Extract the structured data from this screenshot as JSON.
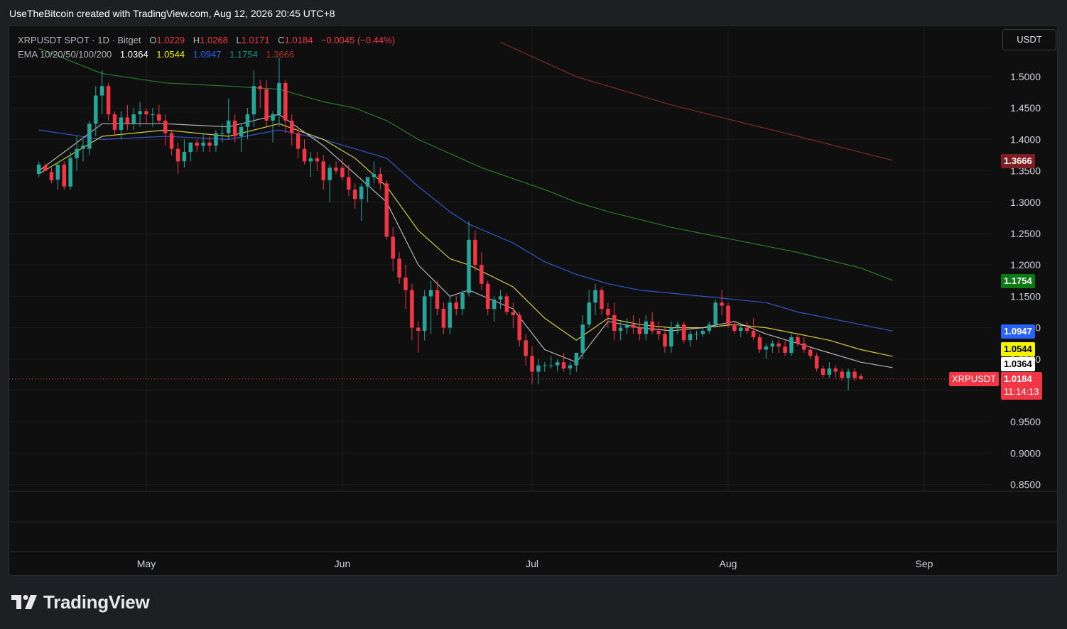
{
  "caption": "UseTheBitcoin created with TradingView.com, Aug 12, 2026 20:45 UTC+8",
  "legend": {
    "symbol": "XRPUSDT SPOT · 1D · Bitget",
    "o_label": "O",
    "o_value": "1.0229",
    "h_label": "H",
    "h_value": "1.0268",
    "l_label": "L",
    "l_value": "1.0171",
    "c_label": "C",
    "c_value": "1.0184",
    "change": "−0.0045 (−0.44%)",
    "ema_label": "EMA 10/20/50/100/200",
    "ema10": "1.0364",
    "ema20": "1.0544",
    "ema50": "1.0947",
    "ema100": "1.1754",
    "ema200": "1.3666"
  },
  "currency_button": "USDT",
  "price_labels": {
    "ema200": "1.3666",
    "ema100": "1.1754",
    "ema50": "1.0947",
    "ema20": "1.0544",
    "ema10": "1.0364",
    "symbol": "XRPUSDT",
    "last": "1.0184",
    "countdown": "11:14:13"
  },
  "colors": {
    "up": "#26a69a",
    "down": "#f23645",
    "ema10": "#c9c9c9",
    "ema20": "#e8e24a",
    "ema50": "#3b5ee0",
    "ema100": "#2e8b2e",
    "ema200": "#8b2f2f",
    "tag_ema200": "#7f1f22",
    "tag_ema100": "#0b7a12",
    "tag_ema50": "#2962ff",
    "tag_ema20": "#f5f500",
    "tag_ema10": "#ffffff",
    "tag_last": "#f23645"
  },
  "brand": "TradingView",
  "chart_data": {
    "type": "candlestick",
    "title": "XRPUSDT SPOT · 1D · Bitget",
    "y_ticks": [
      "1.5000",
      "1.4500",
      "1.4000",
      "1.3500",
      "1.3000",
      "1.2500",
      "1.2000",
      "1.1500",
      "1.1000",
      "1.0500",
      "1.0000",
      "0.9500",
      "0.9000",
      "0.8500"
    ],
    "ylim": [
      0.85,
      1.55
    ],
    "x_ticks": [
      "May",
      "Jun",
      "Jul",
      "Aug",
      "Sep"
    ],
    "x_tick_dates": [
      "2026-05-01",
      "2026-06-01",
      "2026-07-01",
      "2026-08-01",
      "2026-09-01"
    ],
    "start_date": "2026-04-14",
    "candles_ohlc": [
      [
        1.345,
        1.365,
        1.34,
        1.36
      ],
      [
        1.358,
        1.362,
        1.35,
        1.35
      ],
      [
        1.348,
        1.355,
        1.33,
        1.335
      ],
      [
        1.336,
        1.365,
        1.32,
        1.36
      ],
      [
        1.36,
        1.365,
        1.32,
        1.325
      ],
      [
        1.325,
        1.38,
        1.32,
        1.37
      ],
      [
        1.37,
        1.405,
        1.35,
        1.385
      ],
      [
        1.385,
        1.4,
        1.365,
        1.39
      ],
      [
        1.385,
        1.43,
        1.375,
        1.425
      ],
      [
        1.425,
        1.485,
        1.405,
        1.47
      ],
      [
        1.47,
        1.51,
        1.44,
        1.485
      ],
      [
        1.485,
        1.49,
        1.43,
        1.44
      ],
      [
        1.44,
        1.445,
        1.405,
        1.415
      ],
      [
        1.415,
        1.445,
        1.4,
        1.435
      ],
      [
        1.435,
        1.455,
        1.415,
        1.425
      ],
      [
        1.425,
        1.45,
        1.415,
        1.44
      ],
      [
        1.44,
        1.46,
        1.42,
        1.445
      ],
      [
        1.445,
        1.45,
        1.425,
        1.44
      ],
      [
        1.44,
        1.45,
        1.42,
        1.44
      ],
      [
        1.44,
        1.455,
        1.425,
        1.43
      ],
      [
        1.43,
        1.44,
        1.39,
        1.41
      ],
      [
        1.41,
        1.415,
        1.375,
        1.385
      ],
      [
        1.385,
        1.395,
        1.345,
        1.365
      ],
      [
        1.365,
        1.4,
        1.355,
        1.38
      ],
      [
        1.38,
        1.395,
        1.365,
        1.395
      ],
      [
        1.395,
        1.4,
        1.38,
        1.39
      ],
      [
        1.39,
        1.41,
        1.38,
        1.395
      ],
      [
        1.395,
        1.405,
        1.38,
        1.39
      ],
      [
        1.39,
        1.415,
        1.38,
        1.41
      ],
      [
        1.41,
        1.425,
        1.395,
        1.41
      ],
      [
        1.41,
        1.465,
        1.4,
        1.43
      ],
      [
        1.43,
        1.44,
        1.395,
        1.405
      ],
      [
        1.405,
        1.425,
        1.38,
        1.42
      ],
      [
        1.42,
        1.45,
        1.4,
        1.44
      ],
      [
        1.44,
        1.51,
        1.42,
        1.485
      ],
      [
        1.485,
        1.495,
        1.45,
        1.48
      ],
      [
        1.48,
        1.495,
        1.42,
        1.43
      ],
      [
        1.43,
        1.445,
        1.395,
        1.44
      ],
      [
        1.44,
        1.53,
        1.42,
        1.49
      ],
      [
        1.49,
        1.495,
        1.41,
        1.43
      ],
      [
        1.43,
        1.44,
        1.39,
        1.41
      ],
      [
        1.41,
        1.42,
        1.37,
        1.385
      ],
      [
        1.385,
        1.4,
        1.36,
        1.365
      ],
      [
        1.365,
        1.38,
        1.34,
        1.37
      ],
      [
        1.37,
        1.38,
        1.35,
        1.365
      ],
      [
        1.365,
        1.375,
        1.32,
        1.335
      ],
      [
        1.335,
        1.36,
        1.3,
        1.355
      ],
      [
        1.355,
        1.365,
        1.345,
        1.35
      ],
      [
        1.355,
        1.37,
        1.335,
        1.34
      ],
      [
        1.34,
        1.36,
        1.31,
        1.32
      ],
      [
        1.32,
        1.33,
        1.29,
        1.305
      ],
      [
        1.305,
        1.33,
        1.27,
        1.325
      ],
      [
        1.325,
        1.34,
        1.3,
        1.34
      ],
      [
        1.34,
        1.365,
        1.33,
        1.345
      ],
      [
        1.345,
        1.355,
        1.32,
        1.33
      ],
      [
        1.33,
        1.335,
        1.24,
        1.245
      ],
      [
        1.245,
        1.26,
        1.19,
        1.21
      ],
      [
        1.21,
        1.22,
        1.17,
        1.18
      ],
      [
        1.18,
        1.2,
        1.13,
        1.16
      ],
      [
        1.16,
        1.17,
        1.08,
        1.1
      ],
      [
        1.1,
        1.11,
        1.06,
        1.095
      ],
      [
        1.095,
        1.16,
        1.08,
        1.15
      ],
      [
        1.15,
        1.175,
        1.09,
        1.16
      ],
      [
        1.16,
        1.175,
        1.12,
        1.13
      ],
      [
        1.13,
        1.14,
        1.09,
        1.1
      ],
      [
        1.1,
        1.15,
        1.09,
        1.14
      ],
      [
        1.14,
        1.15,
        1.12,
        1.13
      ],
      [
        1.13,
        1.16,
        1.12,
        1.155
      ],
      [
        1.155,
        1.27,
        1.15,
        1.24
      ],
      [
        1.24,
        1.255,
        1.19,
        1.2
      ],
      [
        1.2,
        1.22,
        1.16,
        1.17
      ],
      [
        1.17,
        1.175,
        1.12,
        1.13
      ],
      [
        1.13,
        1.15,
        1.11,
        1.145
      ],
      [
        1.145,
        1.16,
        1.13,
        1.15
      ],
      [
        1.15,
        1.155,
        1.12,
        1.125
      ],
      [
        1.125,
        1.14,
        1.1,
        1.12
      ],
      [
        1.12,
        1.125,
        1.07,
        1.08
      ],
      [
        1.08,
        1.09,
        1.04,
        1.055
      ],
      [
        1.055,
        1.07,
        1.01,
        1.03
      ],
      [
        1.03,
        1.05,
        1.01,
        1.04
      ],
      [
        1.04,
        1.045,
        1.03,
        1.04
      ],
      [
        1.04,
        1.055,
        1.035,
        1.04
      ],
      [
        1.04,
        1.05,
        1.03,
        1.045
      ],
      [
        1.045,
        1.06,
        1.03,
        1.035
      ],
      [
        1.035,
        1.045,
        1.025,
        1.04
      ],
      [
        1.04,
        1.06,
        1.03,
        1.06
      ],
      [
        1.06,
        1.12,
        1.05,
        1.105
      ],
      [
        1.105,
        1.16,
        1.1,
        1.14
      ],
      [
        1.14,
        1.17,
        1.12,
        1.16
      ],
      [
        1.16,
        1.165,
        1.12,
        1.13
      ],
      [
        1.13,
        1.14,
        1.1,
        1.12
      ],
      [
        1.12,
        1.14,
        1.08,
        1.095
      ],
      [
        1.095,
        1.11,
        1.08,
        1.1
      ],
      [
        1.1,
        1.115,
        1.09,
        1.105
      ],
      [
        1.105,
        1.12,
        1.09,
        1.1
      ],
      [
        1.1,
        1.115,
        1.08,
        1.09
      ],
      [
        1.09,
        1.12,
        1.08,
        1.11
      ],
      [
        1.11,
        1.125,
        1.09,
        1.095
      ],
      [
        1.095,
        1.11,
        1.08,
        1.09
      ],
      [
        1.09,
        1.1,
        1.06,
        1.07
      ],
      [
        1.07,
        1.11,
        1.06,
        1.1
      ],
      [
        1.1,
        1.11,
        1.09,
        1.105
      ],
      [
        1.105,
        1.11,
        1.075,
        1.08
      ],
      [
        1.08,
        1.095,
        1.07,
        1.09
      ],
      [
        1.09,
        1.095,
        1.08,
        1.09
      ],
      [
        1.09,
        1.1,
        1.085,
        1.095
      ],
      [
        1.095,
        1.11,
        1.09,
        1.105
      ],
      [
        1.105,
        1.145,
        1.1,
        1.14
      ],
      [
        1.14,
        1.16,
        1.12,
        1.135
      ],
      [
        1.135,
        1.14,
        1.1,
        1.105
      ],
      [
        1.105,
        1.11,
        1.09,
        1.095
      ],
      [
        1.095,
        1.105,
        1.085,
        1.1
      ],
      [
        1.1,
        1.11,
        1.09,
        1.095
      ],
      [
        1.095,
        1.115,
        1.08,
        1.085
      ],
      [
        1.085,
        1.09,
        1.06,
        1.065
      ],
      [
        1.065,
        1.075,
        1.05,
        1.07
      ],
      [
        1.07,
        1.08,
        1.06,
        1.075
      ],
      [
        1.075,
        1.08,
        1.06,
        1.07
      ],
      [
        1.07,
        1.08,
        1.055,
        1.06
      ],
      [
        1.06,
        1.09,
        1.055,
        1.085
      ],
      [
        1.085,
        1.09,
        1.07,
        1.075
      ],
      [
        1.075,
        1.085,
        1.06,
        1.065
      ],
      [
        1.065,
        1.07,
        1.05,
        1.055
      ],
      [
        1.055,
        1.06,
        1.03,
        1.035
      ],
      [
        1.035,
        1.04,
        1.02,
        1.025
      ],
      [
        1.025,
        1.045,
        1.02,
        1.035
      ],
      [
        1.035,
        1.04,
        1.02,
        1.03
      ],
      [
        1.03,
        1.035,
        1.015,
        1.02
      ],
      [
        1.02,
        1.035,
        1.0,
        1.03
      ],
      [
        1.03,
        1.035,
        1.015,
        1.02
      ],
      [
        1.0229,
        1.0268,
        1.0171,
        1.0184
      ]
    ],
    "ema": {
      "ema10_last": 1.0364,
      "ema20_last": 1.0544,
      "ema50_last": 1.0947,
      "ema100_last": 1.1754,
      "ema200_last": 1.3666,
      "ema10_points": [
        [
          0,
          1.35
        ],
        [
          10,
          1.425
        ],
        [
          20,
          1.425
        ],
        [
          30,
          1.42
        ],
        [
          38,
          1.44
        ],
        [
          45,
          1.39
        ],
        [
          50,
          1.345
        ],
        [
          55,
          1.3
        ],
        [
          60,
          1.2
        ],
        [
          65,
          1.15
        ],
        [
          68,
          1.16
        ],
        [
          75,
          1.13
        ],
        [
          80,
          1.065
        ],
        [
          85,
          1.045
        ],
        [
          90,
          1.11
        ],
        [
          95,
          1.1
        ],
        [
          100,
          1.095
        ],
        [
          105,
          1.1
        ],
        [
          110,
          1.11
        ],
        [
          115,
          1.09
        ],
        [
          120,
          1.075
        ],
        [
          125,
          1.06
        ],
        [
          130,
          1.045
        ],
        [
          135,
          1.0364
        ]
      ],
      "ema20_points": [
        [
          0,
          1.345
        ],
        [
          10,
          1.405
        ],
        [
          20,
          1.415
        ],
        [
          30,
          1.405
        ],
        [
          38,
          1.425
        ],
        [
          45,
          1.4
        ],
        [
          50,
          1.37
        ],
        [
          55,
          1.325
        ],
        [
          60,
          1.255
        ],
        [
          65,
          1.21
        ],
        [
          68,
          1.2
        ],
        [
          75,
          1.165
        ],
        [
          80,
          1.115
        ],
        [
          85,
          1.08
        ],
        [
          90,
          1.115
        ],
        [
          95,
          1.105
        ],
        [
          100,
          1.1
        ],
        [
          105,
          1.1
        ],
        [
          110,
          1.105
        ],
        [
          115,
          1.1
        ],
        [
          120,
          1.09
        ],
        [
          125,
          1.08
        ],
        [
          130,
          1.065
        ],
        [
          135,
          1.0544
        ]
      ],
      "ema50_points": [
        [
          0,
          1.415
        ],
        [
          10,
          1.4
        ],
        [
          20,
          1.405
        ],
        [
          30,
          1.4
        ],
        [
          38,
          1.415
        ],
        [
          45,
          1.4
        ],
        [
          50,
          1.385
        ],
        [
          55,
          1.37
        ],
        [
          60,
          1.325
        ],
        [
          65,
          1.285
        ],
        [
          68,
          1.265
        ],
        [
          75,
          1.235
        ],
        [
          80,
          1.205
        ],
        [
          85,
          1.185
        ],
        [
          90,
          1.17
        ],
        [
          95,
          1.16
        ],
        [
          100,
          1.155
        ],
        [
          105,
          1.15
        ],
        [
          110,
          1.145
        ],
        [
          115,
          1.14
        ],
        [
          120,
          1.125
        ],
        [
          125,
          1.115
        ],
        [
          130,
          1.105
        ],
        [
          135,
          1.0947
        ]
      ],
      "ema100_points": [
        [
          0,
          1.545
        ],
        [
          10,
          1.505
        ],
        [
          20,
          1.49
        ],
        [
          30,
          1.485
        ],
        [
          38,
          1.48
        ],
        [
          45,
          1.46
        ],
        [
          50,
          1.45
        ],
        [
          55,
          1.43
        ],
        [
          60,
          1.4
        ],
        [
          70,
          1.355
        ],
        [
          80,
          1.32
        ],
        [
          85,
          1.3
        ],
        [
          90,
          1.285
        ],
        [
          100,
          1.26
        ],
        [
          110,
          1.24
        ],
        [
          120,
          1.22
        ],
        [
          130,
          1.195
        ],
        [
          135,
          1.1754
        ]
      ],
      "ema200_points": [
        [
          73,
          1.555
        ],
        [
          85,
          1.5
        ],
        [
          100,
          1.455
        ],
        [
          120,
          1.405
        ],
        [
          135,
          1.3666
        ]
      ]
    }
  }
}
